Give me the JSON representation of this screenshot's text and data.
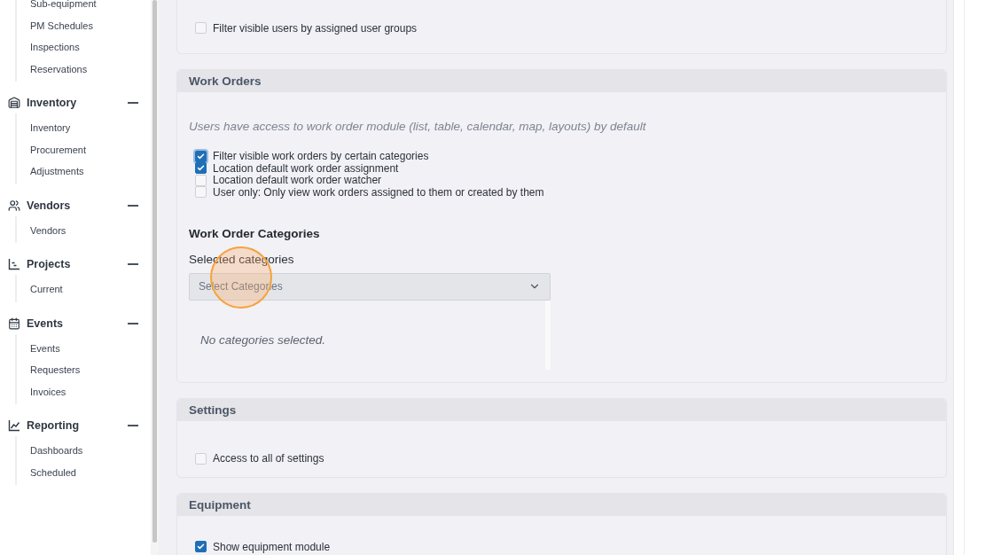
{
  "sidebar": {
    "groups": [
      {
        "items": [
          "Sub-equipment",
          "PM Schedules",
          "Inspections",
          "Reservations"
        ]
      },
      {
        "label": "Inventory",
        "expanded": true,
        "items": [
          "Inventory",
          "Procurement",
          "Adjustments"
        ]
      },
      {
        "label": "Vendors",
        "expanded": true,
        "items": [
          "Vendors"
        ]
      },
      {
        "label": "Projects",
        "expanded": true,
        "items": [
          "Current"
        ]
      },
      {
        "label": "Events",
        "expanded": true,
        "items": [
          "Events",
          "Requesters",
          "Invoices"
        ]
      },
      {
        "label": "Reporting",
        "expanded": true,
        "items": [
          "Dashboards",
          "Scheduled"
        ]
      }
    ]
  },
  "sections": [
    {
      "checkboxes": [
        {
          "label": "Filter visible users by assigned user groups",
          "checked": false,
          "focused": false
        }
      ]
    },
    {
      "title": "Work Orders",
      "note": "Users have access to work order module (list, table, calendar, map, layouts) by default",
      "checkboxes": [
        {
          "label": "Filter visible work orders by certain categories",
          "checked": true,
          "focused": true
        },
        {
          "label": "Location default work order assignment",
          "checked": true,
          "focused": false
        },
        {
          "label": "Location default work order watcher",
          "checked": false,
          "focused": false
        },
        {
          "label": "User only: Only view work orders assigned to them or created by them",
          "checked": false,
          "focused": false
        }
      ],
      "categories": {
        "heading": "Work Order Categories",
        "label": "Selected categories",
        "placeholder": "Select Categories",
        "empty": "No categories selected."
      }
    },
    {
      "title": "Settings",
      "checkboxes": [
        {
          "label": "Access to all of settings",
          "checked": false,
          "focused": false
        }
      ]
    },
    {
      "title": "Equipment",
      "checkboxes": [
        {
          "label": "Show equipment module",
          "checked": true,
          "focused": false
        }
      ]
    }
  ]
}
